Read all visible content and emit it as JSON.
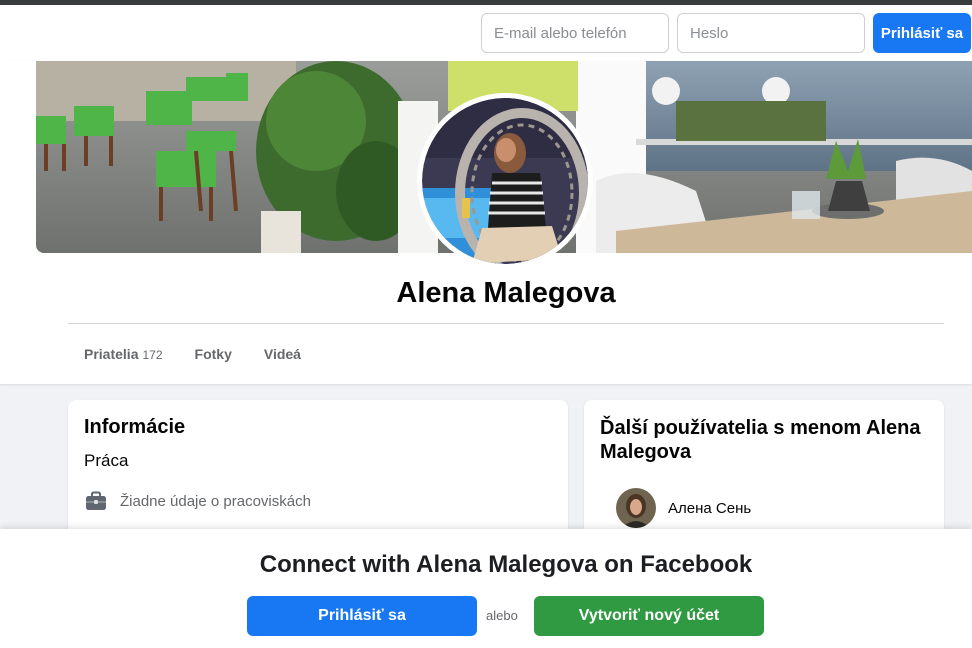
{
  "login": {
    "email_placeholder": "E-mail alebo telefón",
    "password_placeholder": "Heslo",
    "button": "Prihlásiť sa"
  },
  "profile": {
    "name": "Alena Malegova",
    "tabs": [
      {
        "label": "Priatelia",
        "count": "172"
      },
      {
        "label": "Fotky",
        "count": ""
      },
      {
        "label": "Videá",
        "count": ""
      }
    ]
  },
  "info": {
    "title": "Informácie",
    "work_heading": "Práca",
    "work_empty": "Žiadne údaje o pracoviskách",
    "work_icon": "briefcase-icon"
  },
  "others": {
    "title": "Ďalší používatelia s menom Alena Malegova",
    "people": [
      {
        "name": "Алена Сень"
      }
    ]
  },
  "connect": {
    "title": "Connect with Alena Malegova on Facebook",
    "login_button": "Prihlásiť sa",
    "or": "alebo",
    "create_button": "Vytvoriť nový účet"
  },
  "colors": {
    "primary": "#1877f2",
    "create": "#2f9a41"
  }
}
